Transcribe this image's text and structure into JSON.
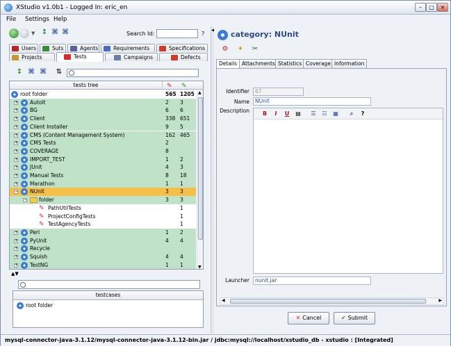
{
  "window": {
    "title": "XStudio v1.0b1 - Logged In: eric_en"
  },
  "menu": [
    "File",
    "Settings",
    "Help"
  ],
  "nav": {
    "search_label": "Search Id:",
    "search_value": "",
    "help": "?"
  },
  "tabs_row1": [
    {
      "label": "Users",
      "color": "#b8252c"
    },
    {
      "label": "Suts",
      "color": "#3c8a3c"
    },
    {
      "label": "Agents",
      "color": "#5b5f9e"
    },
    {
      "label": "Requirements",
      "color": "#4a6cc0"
    },
    {
      "label": "Specifications",
      "color": "#cf3a2c"
    }
  ],
  "tabs_row2": [
    {
      "label": "Projects",
      "color": "#c49a2b"
    },
    {
      "label": "Tests",
      "color": "#d92a2a"
    },
    {
      "label": "Campaigns",
      "color": "#6a7ea8"
    },
    {
      "label": "Defects",
      "color": "#d13a25"
    }
  ],
  "tree": {
    "header": "tests tree",
    "root": {
      "name": "root folder",
      "c1": "565",
      "c2": "1205"
    },
    "rows": [
      {
        "name": "AutoIt",
        "c1": "2",
        "c2": "3",
        "kind": "cat",
        "depth": 0
      },
      {
        "name": "BG",
        "c1": "6",
        "c2": "6",
        "kind": "cat",
        "depth": 0
      },
      {
        "name": "Client",
        "c1": "338",
        "c2": "651",
        "kind": "cat",
        "depth": 0
      },
      {
        "name": "Client Installer",
        "c1": "9",
        "c2": "5",
        "kind": "cat",
        "depth": 0
      },
      {
        "name": "CMS (Content Management System)",
        "c1": "162",
        "c2": "465",
        "kind": "cat",
        "depth": 0
      },
      {
        "name": "CMS Tests",
        "c1": "2",
        "c2": "",
        "kind": "cat",
        "depth": 0
      },
      {
        "name": "COVERAGE",
        "c1": "8",
        "c2": "",
        "kind": "cat",
        "depth": 0
      },
      {
        "name": "IMPORT_TEST",
        "c1": "1",
        "c2": "2",
        "kind": "cat",
        "depth": 0
      },
      {
        "name": "JUnit",
        "c1": "4",
        "c2": "3",
        "kind": "cat",
        "depth": 0
      },
      {
        "name": "Manual Tests",
        "c1": "8",
        "c2": "18",
        "kind": "cat",
        "depth": 0
      },
      {
        "name": "Marathon",
        "c1": "1",
        "c2": "1",
        "kind": "cat",
        "depth": 0
      },
      {
        "name": "NUnit",
        "c1": "3",
        "c2": "3",
        "kind": "cat",
        "depth": 0,
        "selected": true
      },
      {
        "name": "folder",
        "c1": "3",
        "c2": "3",
        "kind": "folder",
        "depth": 1
      },
      {
        "name": "PathUtilTests",
        "c1": "",
        "c2": "1",
        "kind": "test",
        "depth": 2
      },
      {
        "name": "ProjectConfigTests",
        "c1": "",
        "c2": "1",
        "kind": "test",
        "depth": 2
      },
      {
        "name": "TestAgencyTests",
        "c1": "",
        "c2": "1",
        "kind": "test",
        "depth": 2
      },
      {
        "name": "Perl",
        "c1": "1",
        "c2": "2",
        "kind": "cat",
        "depth": 0
      },
      {
        "name": "PyUnit",
        "c1": "4",
        "c2": "4",
        "kind": "cat",
        "depth": 0
      },
      {
        "name": "Recycle",
        "c1": "",
        "c2": "",
        "kind": "cat",
        "depth": 0
      },
      {
        "name": "Squish",
        "c1": "4",
        "c2": "4",
        "kind": "cat",
        "depth": 0
      },
      {
        "name": "TestNG",
        "c1": "1",
        "c2": "1",
        "kind": "cat",
        "depth": 0
      }
    ]
  },
  "testcases": {
    "header": "testcases",
    "root": "root folder"
  },
  "detail": {
    "title": "category: NUnit",
    "tabs": [
      "Details",
      "Attachments",
      "Statistics",
      "Coverage",
      "Information"
    ],
    "identifier_label": "Identifier",
    "identifier_value": "67",
    "name_label": "Name",
    "name_value": "NUnit",
    "description_label": "Description",
    "launcher_label": "Launcher",
    "launcher_value": "nunit.jar",
    "editor_tools": [
      "B",
      "I",
      "U",
      "doc-icon",
      "bullet-list-icon",
      "numbered-list-icon",
      "table-icon",
      "search-icon",
      "?"
    ],
    "cancel_label": "Cancel",
    "submit_label": "Submit"
  },
  "status": "mysql-connector-java-3.1.12/mysql-connector-java-3.1.12-bin.jar / jdbc:mysql://localhost/xstudio_db - xstudio : [Integrated]"
}
